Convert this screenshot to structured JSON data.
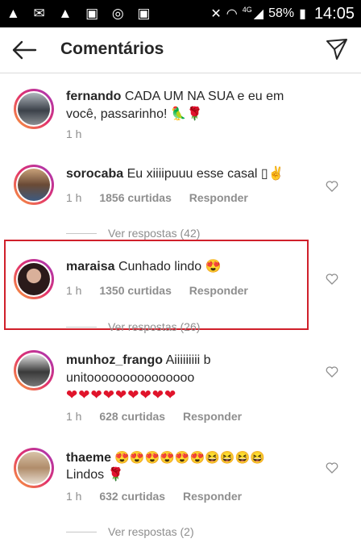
{
  "status_bar": {
    "left_icons": "▲ ✉ ▲ ▣ ◎ ▣",
    "network": "4G",
    "battery": "58%",
    "time": "14:05"
  },
  "header": {
    "title": "Comentários"
  },
  "comments": [
    {
      "user": "fernando",
      "text": " CADA UM NA SUA e eu em você, passarinho! 🦜🌹",
      "time": "1 h",
      "likes": "",
      "reply": ""
    },
    {
      "user": "sorocaba",
      "text": " Eu xiiiipuuu esse casal ▯✌",
      "time": "1 h",
      "likes": "1856 curtidas",
      "reply": "Responder",
      "view_replies": "Ver respostas (42)"
    },
    {
      "user": "maraisa",
      "text": " Cunhado lindo 😍",
      "time": "1 h",
      "likes": "1350 curtidas",
      "reply": "Responder",
      "view_replies": "Ver respostas (26)"
    },
    {
      "user": "munhoz_frango",
      "text": " Aiiiiiiiii bunitooooooooooooooo",
      "hearts": "❤❤❤❤❤❤❤❤❤",
      "time": "1 h",
      "likes": "628 curtidas",
      "reply": "Responder"
    },
    {
      "user": "thaeme",
      "text": " 😍😍😍😍😍😍😆😆😆😆",
      "text2": "Lindos 🌹",
      "time": "1 h",
      "likes": "632 curtidas",
      "reply": "Responder",
      "view_replies": "Ver respostas (2)"
    }
  ],
  "colors": {
    "highlight": "#d0202b",
    "meta_gray": "#8e8e8e",
    "text": "#262626"
  }
}
